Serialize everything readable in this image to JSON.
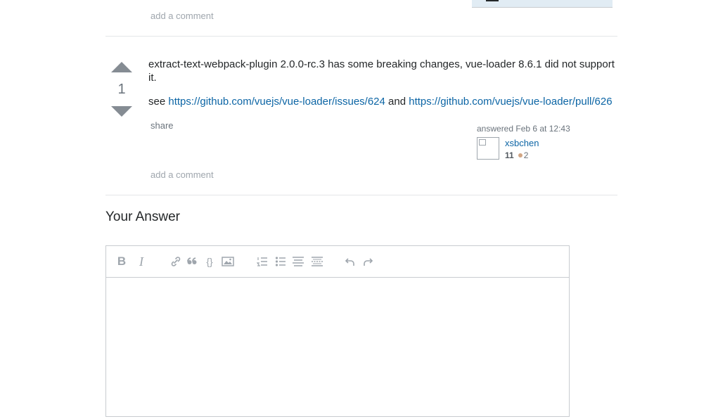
{
  "previous_answer": {
    "add_comment_label": "add a comment"
  },
  "answer": {
    "vote_count": "1",
    "body_line1": "extract-text-webpack-plugin 2.0.0-rc.3 has some breaking changes, vue-loader 8.6.1 did not support it.",
    "see_label": "see",
    "link1_text": "https://github.com/vuejs/vue-loader/issues/624",
    "and_label": "and",
    "link2_text": "https://github.com/vuejs/vue-loader/pull/626",
    "share_label": "share",
    "answered_label": "answered Feb 6 at 12:43",
    "user_name": "xsbchen",
    "user_reputation": "11",
    "bronze_badges": "2",
    "add_comment_label": "add a comment"
  },
  "your_answer": {
    "heading": "Your Answer",
    "toolbar": [
      {
        "name": "bold-icon",
        "glyph": "B"
      },
      {
        "name": "italic-icon",
        "glyph": "I"
      },
      {
        "name": "link-icon"
      },
      {
        "name": "blockquote-icon"
      },
      {
        "name": "code-icon",
        "glyph": "{}"
      },
      {
        "name": "image-icon"
      },
      {
        "name": "numbered-list-icon"
      },
      {
        "name": "bulleted-list-icon"
      },
      {
        "name": "heading-icon"
      },
      {
        "name": "horizontal-rule-icon"
      },
      {
        "name": "undo-icon"
      },
      {
        "name": "redo-icon"
      }
    ],
    "textarea_value": ""
  },
  "colors": {
    "link": "#0c65a5",
    "muted": "#9fa6ad",
    "vote_arrow": "#858c93",
    "bronze": "#d1a684",
    "border": "#c8ccd0"
  }
}
